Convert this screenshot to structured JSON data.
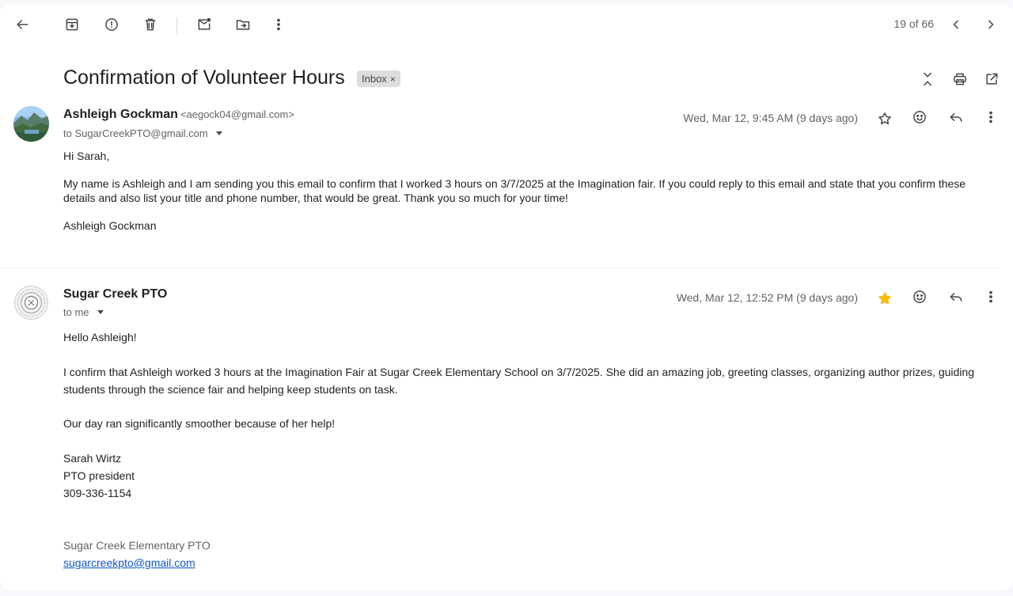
{
  "toolbar": {
    "pager": "19 of 66"
  },
  "thread": {
    "subject": "Confirmation of Volunteer Hours",
    "label": "Inbox",
    "label_remove": "×"
  },
  "messages": [
    {
      "sender_name": "Ashleigh Gockman",
      "sender_email": "<aegock04@gmail.com>",
      "to": "to SugarCreekPTO@gmail.com",
      "date": "Wed, Mar 12, 9:45 AM (9 days ago)",
      "starred": false,
      "greeting": "Hi Sarah,",
      "paragraph": "My name is Ashleigh and I am sending you this email to confirm that I worked 3 hours on 3/7/2025 at the Imagination fair. If you could reply to this email and state that you confirm these details and also list your title and phone number, that would be great. Thank you so much for your time!",
      "signoff": "Ashleigh Gockman"
    },
    {
      "sender_name": "Sugar Creek PTO",
      "to": "to me",
      "date": "Wed, Mar 12, 12:52 PM (9 days ago)",
      "starred": true,
      "greeting": "Hello Ashleigh!",
      "paragraph": "I confirm that Ashleigh worked 3 hours at the Imagination Fair at Sugar Creek Elementary School on 3/7/2025.  She did an amazing job, greeting classes, organizing author prizes, guiding students through the science fair and helping keep students on task.",
      "paragraph2": "Our day ran significantly smoother because of her help!",
      "sig_name": "Sarah Wirtz",
      "sig_title": "PTO president",
      "sig_phone": "309-336-1154",
      "org_name": "Sugar Creek Elementary PTO",
      "org_email": "sugarcreekpto@gmail.com"
    }
  ],
  "colors": {
    "star_active": "#fbbc04",
    "link": "#1155cc",
    "background": "#f6f8fc"
  }
}
